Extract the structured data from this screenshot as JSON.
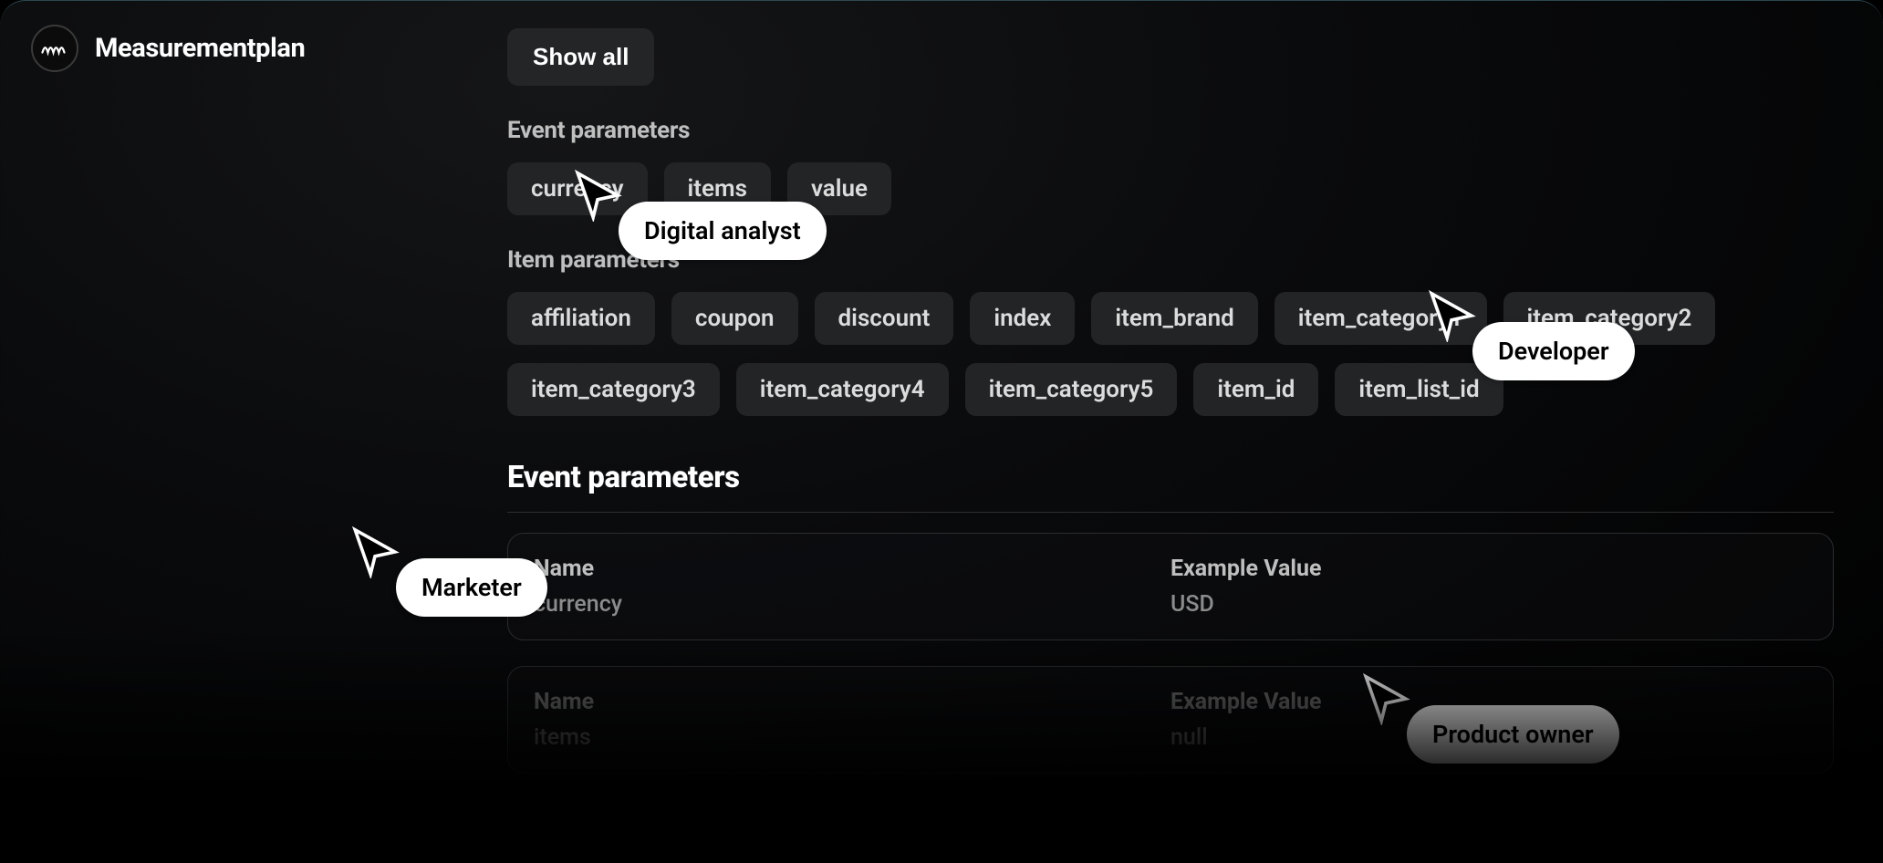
{
  "app": {
    "title": "Measurementplan"
  },
  "buttons": {
    "show_all": "Show all"
  },
  "sections": {
    "event_params_label": "Event parameters",
    "item_params_label": "Item parameters",
    "event_params_heading": "Event parameters"
  },
  "event_param_chips": [
    "currency",
    "items",
    "value"
  ],
  "item_param_chips_row1": [
    "affiliation",
    "coupon",
    "discount",
    "index",
    "item_brand",
    "item_category1",
    "item_category2"
  ],
  "item_param_chips_row2": [
    "item_category3",
    "item_category4",
    "item_category5",
    "item_id",
    "item_list_id"
  ],
  "table": {
    "name_label": "Name",
    "example_label": "Example Value",
    "rows": [
      {
        "name": "currency",
        "example": "USD"
      },
      {
        "name": "items",
        "example": "null"
      }
    ]
  },
  "cursors": {
    "analyst": "Digital analyst",
    "marketer": "Marketer",
    "developer": "Developer",
    "product_owner": "Product owner"
  }
}
